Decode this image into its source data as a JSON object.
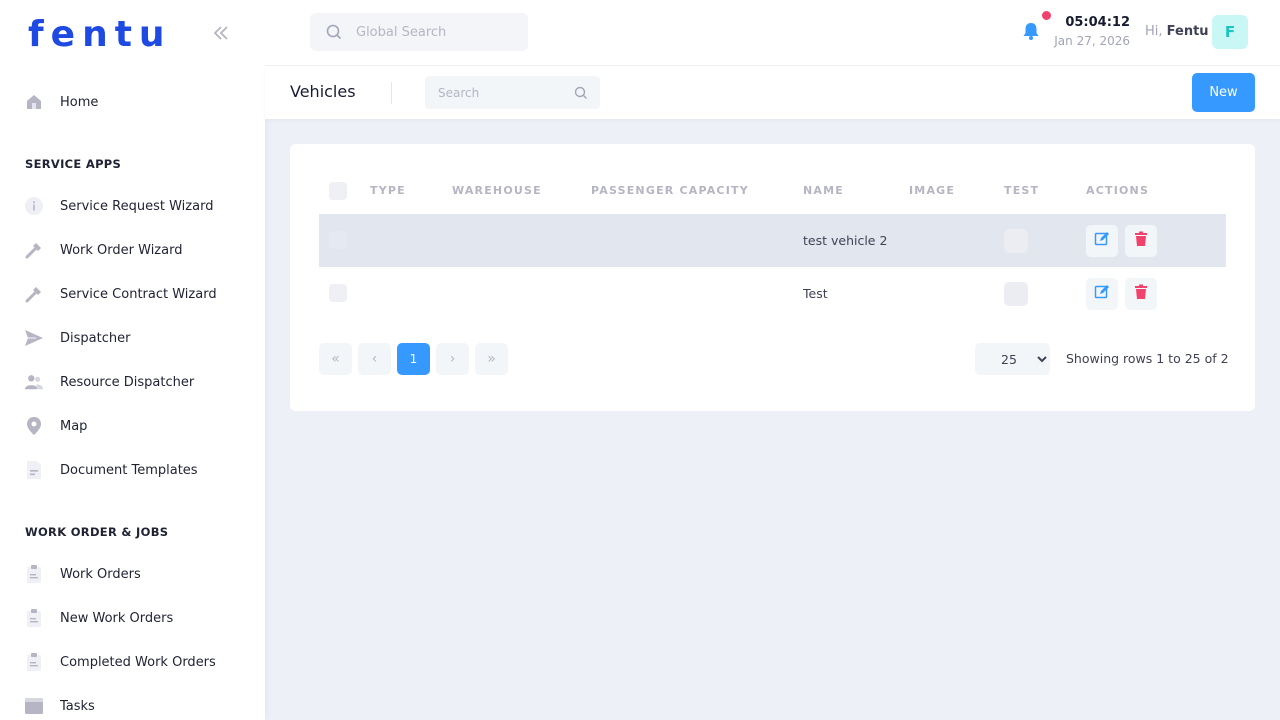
{
  "brand": {
    "logo_text": "fentu"
  },
  "sidebar": {
    "items_top": [
      {
        "label": "Home",
        "icon": "home-icon"
      }
    ],
    "sections": [
      {
        "title": "SERVICE APPS",
        "items": [
          {
            "label": "Service Request Wizard",
            "icon": "info-icon"
          },
          {
            "label": "Work Order Wizard",
            "icon": "wrench-icon"
          },
          {
            "label": "Service Contract Wizard",
            "icon": "wrench-icon"
          },
          {
            "label": "Dispatcher",
            "icon": "send-icon"
          },
          {
            "label": "Resource Dispatcher",
            "icon": "users-icon"
          },
          {
            "label": "Map",
            "icon": "map-pin-icon"
          },
          {
            "label": "Document Templates",
            "icon": "document-icon"
          }
        ]
      },
      {
        "title": "WORK ORDER & JOBS",
        "items": [
          {
            "label": "Work Orders",
            "icon": "clipboard-icon"
          },
          {
            "label": "New Work Orders",
            "icon": "clipboard-icon"
          },
          {
            "label": "Completed Work Orders",
            "icon": "clipboard-icon"
          },
          {
            "label": "Tasks",
            "icon": "folder-icon"
          }
        ]
      }
    ]
  },
  "header": {
    "search_placeholder": "Global Search",
    "time": "05:04:12",
    "date": "Jan 27, 2026",
    "greeting": "Hi,",
    "user_name": "Fentu",
    "avatar_initial": "F"
  },
  "subheader": {
    "title": "Vehicles",
    "search_placeholder": "Search",
    "new_label": "New"
  },
  "table": {
    "columns": [
      "TYPE",
      "WAREHOUSE",
      "PASSENGER CAPACITY",
      "NAME",
      "IMAGE",
      "TEST",
      "ACTIONS"
    ],
    "rows": [
      {
        "type": "",
        "warehouse": "",
        "passenger_capacity": "",
        "name": "test vehicle 2",
        "image": ""
      },
      {
        "type": "",
        "warehouse": "",
        "passenger_capacity": "",
        "name": "Test",
        "image": ""
      }
    ]
  },
  "pagination": {
    "first": "«",
    "prev": "‹",
    "current_page": "1",
    "next": "›",
    "last": "»",
    "page_size": "25",
    "page_size_options": [
      "25"
    ],
    "summary": "Showing rows 1 to 25 of 2"
  },
  "colors": {
    "brand": "#1e49e2",
    "primary": "#3699ff",
    "danger": "#f1416c",
    "avatar_bg": "#c9f7f5",
    "avatar_fg": "#1bc5bd"
  }
}
